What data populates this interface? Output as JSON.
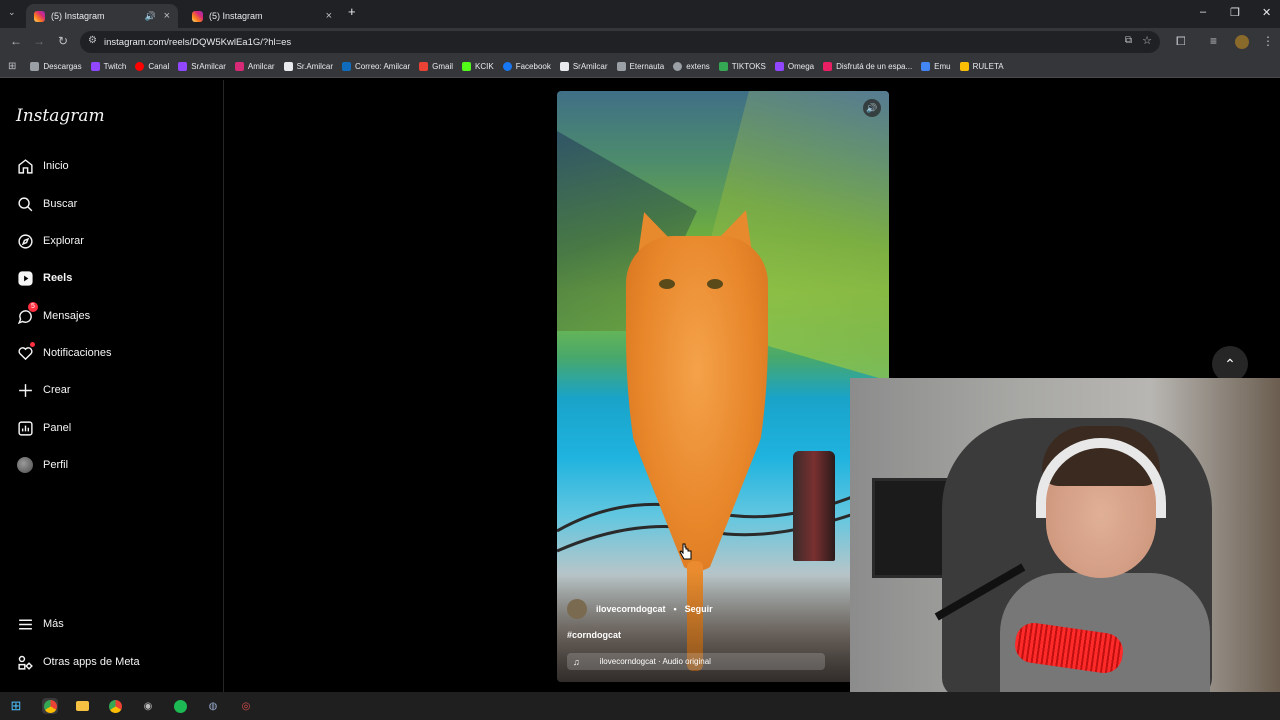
{
  "browser": {
    "tabs": [
      {
        "label": "(5) Instagram",
        "active": true
      },
      {
        "label": "(5) Instagram",
        "active": false
      }
    ],
    "url": "instagram.com/reels/DQW5KwlEa1G/?hl=es",
    "bookmarks": [
      {
        "label": "Descargas",
        "color": "#9aa0a6"
      },
      {
        "label": "Twitch",
        "color": "#9146ff"
      },
      {
        "label": "Canal",
        "color": "#ff0000"
      },
      {
        "label": "SrAmilcar",
        "color": "#9146ff"
      },
      {
        "label": "Amilcar",
        "color": "#d62976"
      },
      {
        "label": "Sr.Amilcar",
        "color": "#e8eaed"
      },
      {
        "label": "Correo: Amilcar",
        "color": "#0f6cbd"
      },
      {
        "label": "Gmail",
        "color": "#ea4335"
      },
      {
        "label": "KCIK",
        "color": "#53fc18"
      },
      {
        "label": "Facebook",
        "color": "#1877f2"
      },
      {
        "label": "SrAmilcar",
        "color": "#e8eaed"
      },
      {
        "label": "Eternauta",
        "color": "#9aa0a6"
      },
      {
        "label": "extens",
        "color": "#9aa0a6"
      },
      {
        "label": "TIKTOKS",
        "color": "#34a853"
      },
      {
        "label": "Omega",
        "color": "#9146ff"
      },
      {
        "label": "Disfrutá de un espa...",
        "color": "#e91e63"
      },
      {
        "label": "Emu",
        "color": "#4285f4"
      },
      {
        "label": "RULETA",
        "color": "#fbbc04"
      }
    ]
  },
  "sidebar": {
    "logo": "Instagram",
    "items": [
      {
        "label": "Inicio",
        "icon": "home-icon"
      },
      {
        "label": "Buscar",
        "icon": "search-icon"
      },
      {
        "label": "Explorar",
        "icon": "compass-icon"
      },
      {
        "label": "Reels",
        "icon": "reels-icon"
      },
      {
        "label": "Mensajes",
        "icon": "messenger-icon",
        "badge": "5"
      },
      {
        "label": "Notificaciones",
        "icon": "heart-icon"
      },
      {
        "label": "Crear",
        "icon": "plus-icon"
      },
      {
        "label": "Panel",
        "icon": "chart-icon"
      },
      {
        "label": "Perfil",
        "icon": "avatar-icon"
      }
    ],
    "footer": [
      {
        "label": "Más",
        "icon": "menu-icon"
      },
      {
        "label": "Otras apps de Meta",
        "icon": "meta-apps-icon"
      }
    ]
  },
  "reel": {
    "author": "ilovecorndogcat",
    "separator": "•",
    "follow": "Seguir",
    "caption": "#corndogcat",
    "audio": "ilovecorndogcat · Audio original"
  }
}
